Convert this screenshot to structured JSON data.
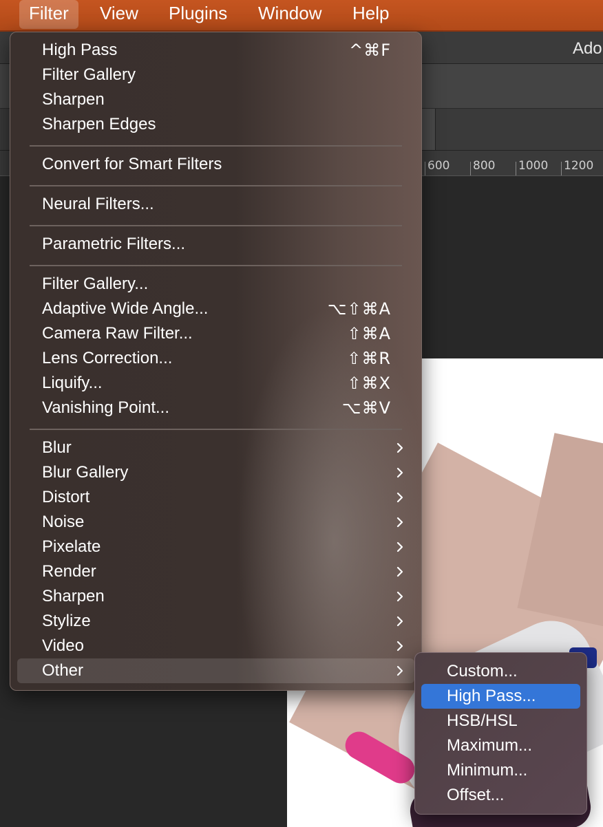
{
  "menubar": {
    "items": [
      {
        "label": "Filter",
        "active": true
      },
      {
        "label": "View"
      },
      {
        "label": "Plugins"
      },
      {
        "label": "Window"
      },
      {
        "label": "Help"
      }
    ]
  },
  "app": {
    "title": "Adol",
    "ruler_labels": [
      "600",
      "800",
      "1000",
      "1200"
    ]
  },
  "filter_menu": {
    "items": [
      {
        "label": "High Pass",
        "shortcut": "^⌘F"
      },
      {
        "label": "Filter Gallery",
        "shortcut": ""
      },
      {
        "label": "Sharpen",
        "shortcut": ""
      },
      {
        "label": "Sharpen Edges",
        "shortcut": ""
      },
      {
        "label": "Convert for Smart Filters",
        "shortcut": ""
      },
      {
        "label": "Neural Filters...",
        "shortcut": ""
      },
      {
        "label": "Parametric Filters...",
        "shortcut": ""
      },
      {
        "label": "Filter Gallery...",
        "shortcut": ""
      },
      {
        "label": "Adaptive Wide Angle...",
        "shortcut": "⌥⇧⌘A"
      },
      {
        "label": "Camera Raw Filter...",
        "shortcut": "⇧⌘A"
      },
      {
        "label": "Lens Correction...",
        "shortcut": "⇧⌘R"
      },
      {
        "label": "Liquify...",
        "shortcut": "⇧⌘X"
      },
      {
        "label": "Vanishing Point...",
        "shortcut": "⌥⌘V"
      },
      {
        "label": "Blur",
        "submenu": true
      },
      {
        "label": "Blur Gallery",
        "submenu": true
      },
      {
        "label": "Distort",
        "submenu": true
      },
      {
        "label": "Noise",
        "submenu": true
      },
      {
        "label": "Pixelate",
        "submenu": true
      },
      {
        "label": "Render",
        "submenu": true
      },
      {
        "label": "Sharpen",
        "submenu": true
      },
      {
        "label": "Stylize",
        "submenu": true
      },
      {
        "label": "Video",
        "submenu": true
      },
      {
        "label": "Other",
        "submenu": true,
        "highlighted": true
      }
    ]
  },
  "other_submenu": {
    "items": [
      {
        "label": "Custom..."
      },
      {
        "label": "High Pass...",
        "selected": true
      },
      {
        "label": "HSB/HSL"
      },
      {
        "label": "Maximum..."
      },
      {
        "label": "Minimum..."
      },
      {
        "label": "Offset..."
      }
    ]
  },
  "colors": {
    "menubar": "#b24a19",
    "selection": "#3476d8",
    "menu_text": "#ffffff"
  }
}
